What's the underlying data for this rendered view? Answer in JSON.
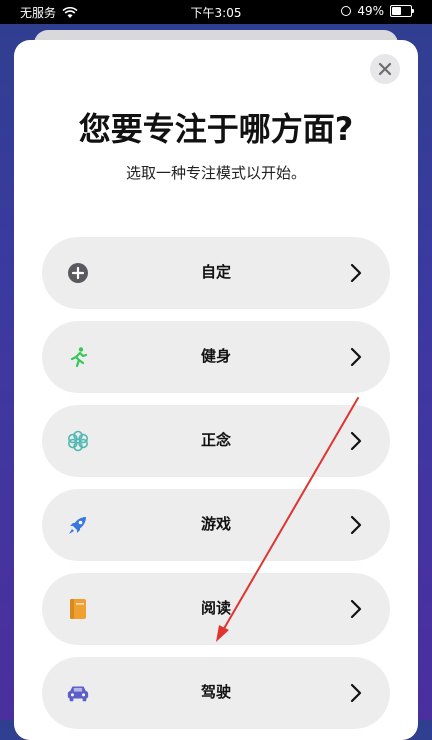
{
  "status_bar": {
    "carrier": "无服务",
    "time": "下午3:05",
    "battery_percent": "49%",
    "battery_level": 0.49
  },
  "sheet": {
    "title": "您要专注于哪方面?",
    "subtitle": "选取一种专注模式以开始。",
    "close_icon": "close-icon"
  },
  "options": [
    {
      "label": "自定",
      "icon": "plus-circle-icon",
      "color": "#5a5a5e"
    },
    {
      "label": "健身",
      "icon": "running-figure-icon",
      "color": "#34c759"
    },
    {
      "label": "正念",
      "icon": "flower-icon",
      "color": "#4fb8b0"
    },
    {
      "label": "游戏",
      "icon": "rocket-icon",
      "color": "#3a78e0"
    },
    {
      "label": "阅读",
      "icon": "book-icon",
      "color": "#f0a030"
    },
    {
      "label": "驾驶",
      "icon": "car-icon",
      "color": "#5b5fc7"
    }
  ],
  "annotation": {
    "color": "#e0342f"
  }
}
